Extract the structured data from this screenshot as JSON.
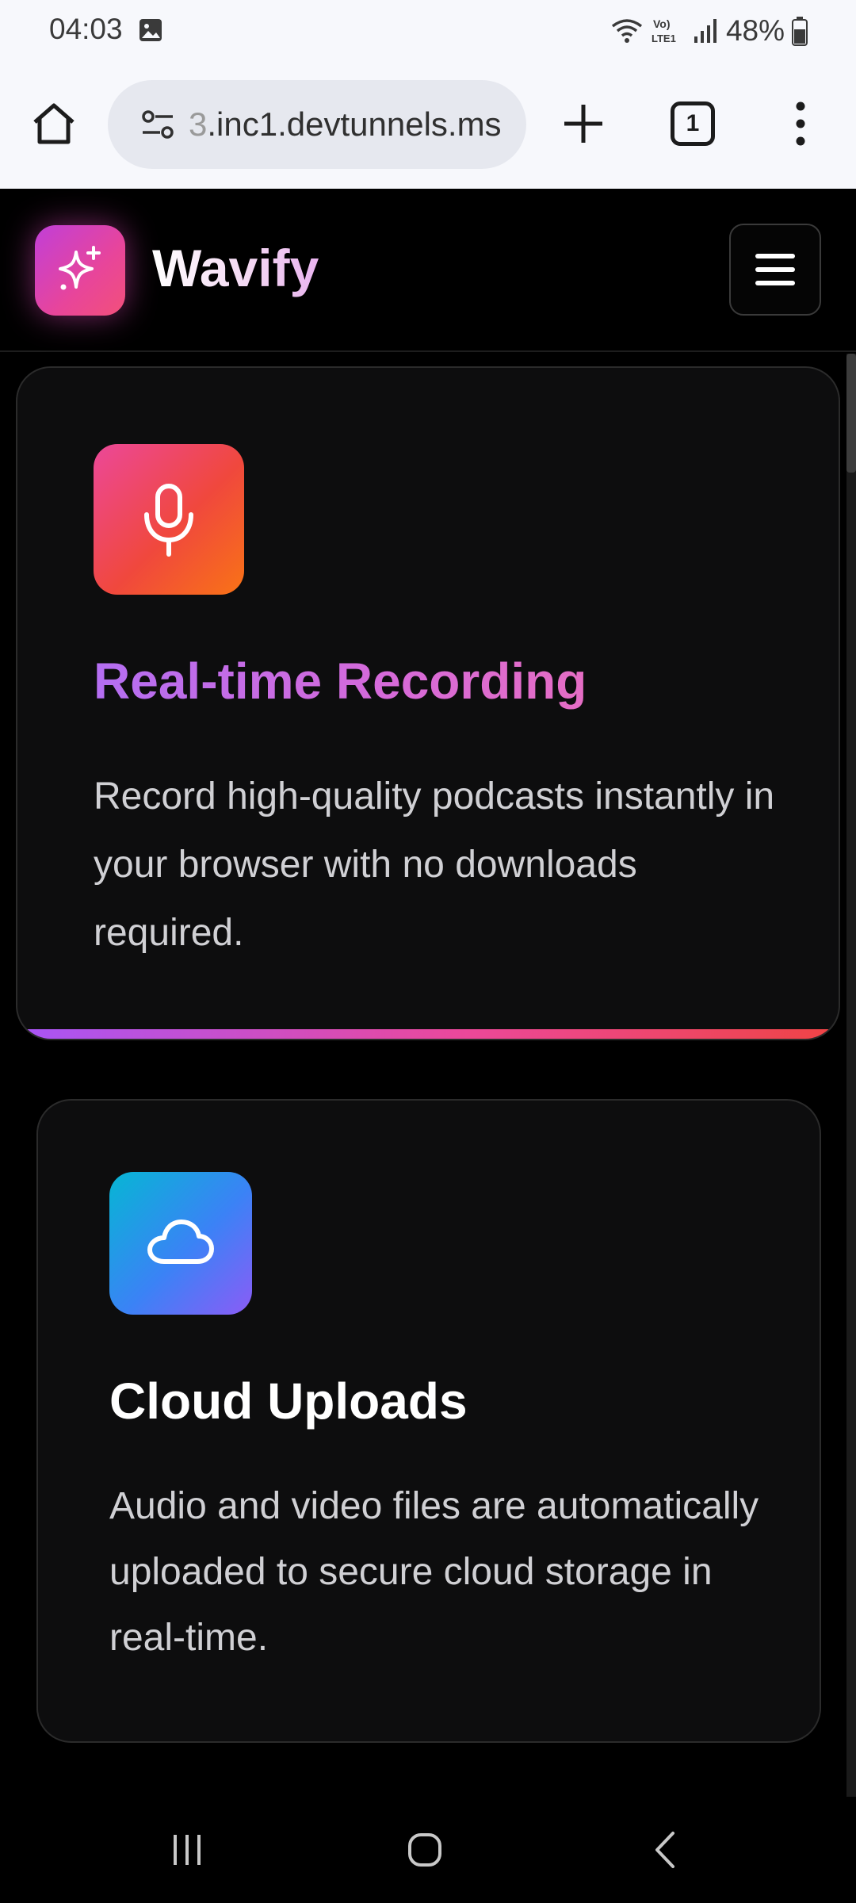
{
  "status_bar": {
    "time": "04:03",
    "battery_percent": "48%",
    "icons": [
      "image-icon",
      "wifi-icon",
      "volte-icon",
      "signal-icon",
      "battery-icon"
    ],
    "volte_label": "Vo) LTE1"
  },
  "browser": {
    "url_faded": "3",
    "url": ".inc1.devtunnels.ms",
    "tab_count": "1",
    "icons": [
      "home-icon",
      "site-settings-icon",
      "new-tab-icon",
      "tabs-icon",
      "more-vert-icon"
    ]
  },
  "site": {
    "brand": "Wavify",
    "logo_icon": "sparkles-icon",
    "menu_icon": "hamburger-icon"
  },
  "features": [
    {
      "icon": "microphone-icon",
      "title": "Real-time Recording",
      "description": "Record high-quality podcasts instantly in your browser with no downloads required."
    },
    {
      "icon": "cloud-icon",
      "title": "Cloud Uploads",
      "description": "Audio and video files are automatically uploaded to secure cloud storage in real-time."
    }
  ],
  "nav_bar": {
    "icons": [
      "recent-apps-icon",
      "home-button-icon",
      "back-icon"
    ]
  },
  "colors": {
    "page_bg": "#000000",
    "card_bg": "#0d0d0e",
    "accent_pink": "#ec4899",
    "accent_purple": "#a855f7",
    "accent_blue": "#3b82f6"
  }
}
